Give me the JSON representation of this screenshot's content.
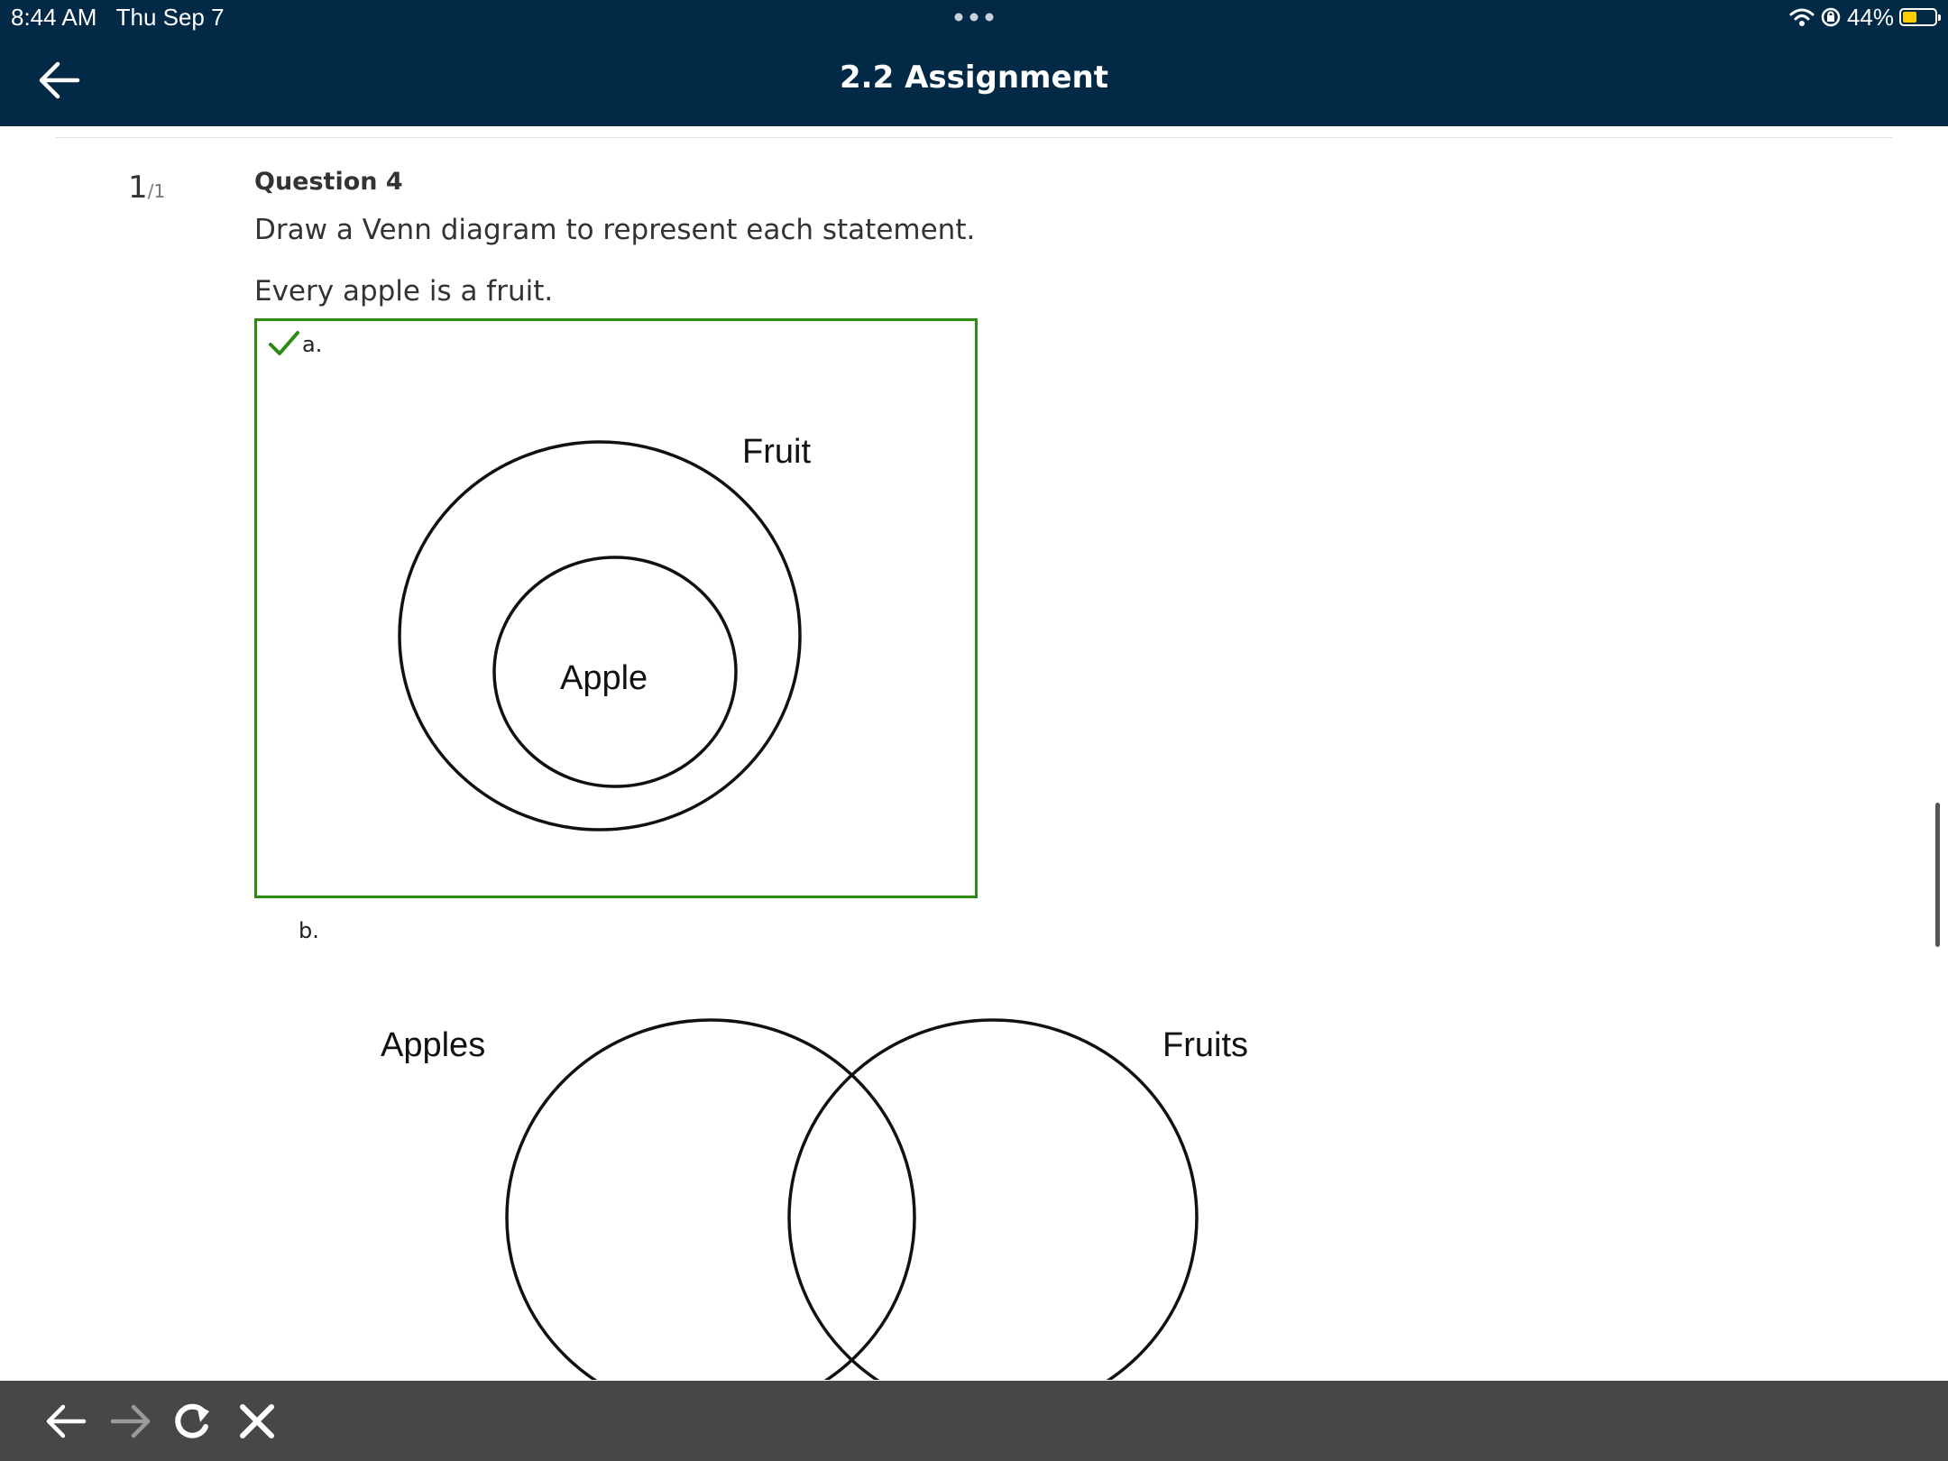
{
  "status_bar": {
    "time": "8:44 AM",
    "date": "Thu Sep 7",
    "battery": "44%",
    "battery_level": 0.44,
    "icons": [
      "more-dots-icon",
      "wifi-icon",
      "orientation-lock-icon",
      "battery-icon"
    ]
  },
  "header": {
    "title": "2.2 Assignment",
    "background": "#022a47"
  },
  "question": {
    "score": "1",
    "score_total": "/1",
    "label": "Question 4",
    "prompt": "Draw a Venn diagram to represent each statement.",
    "statement": "Every apple is a fruit."
  },
  "options": [
    {
      "letter": "a.",
      "selected": true,
      "correct": true,
      "outer_label": "Fruit",
      "inner_label": "Apple",
      "border_color": "#2e8b12"
    },
    {
      "letter": "b.",
      "selected": false,
      "left_label": "Apples",
      "right_label": "Fruits"
    }
  ],
  "bottom_bar": {
    "icons": [
      "back-arrow-icon",
      "forward-arrow-icon",
      "reload-icon",
      "close-icon"
    ],
    "background": "#474747"
  }
}
